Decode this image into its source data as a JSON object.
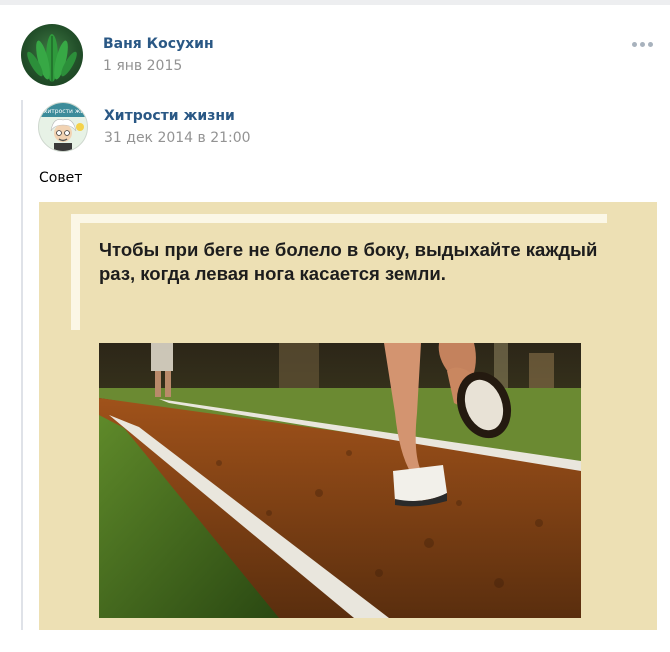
{
  "post": {
    "author": "Ваня Косухин",
    "date": "1 янв 2015",
    "more_icon": "ellipsis-icon",
    "text": "Совет"
  },
  "repost": {
    "source_name": "Хитрости жизни",
    "date": "31 дек 2014 в 21:00"
  },
  "image": {
    "caption": "Чтобы при беге не болело в боку, выдыхайте каждый раз, когда левая нога касается земли.",
    "avatar_caption": "хитрости жи"
  },
  "colors": {
    "link": "#2a5885",
    "muted": "#939393",
    "image_background": "#ede0b4"
  }
}
